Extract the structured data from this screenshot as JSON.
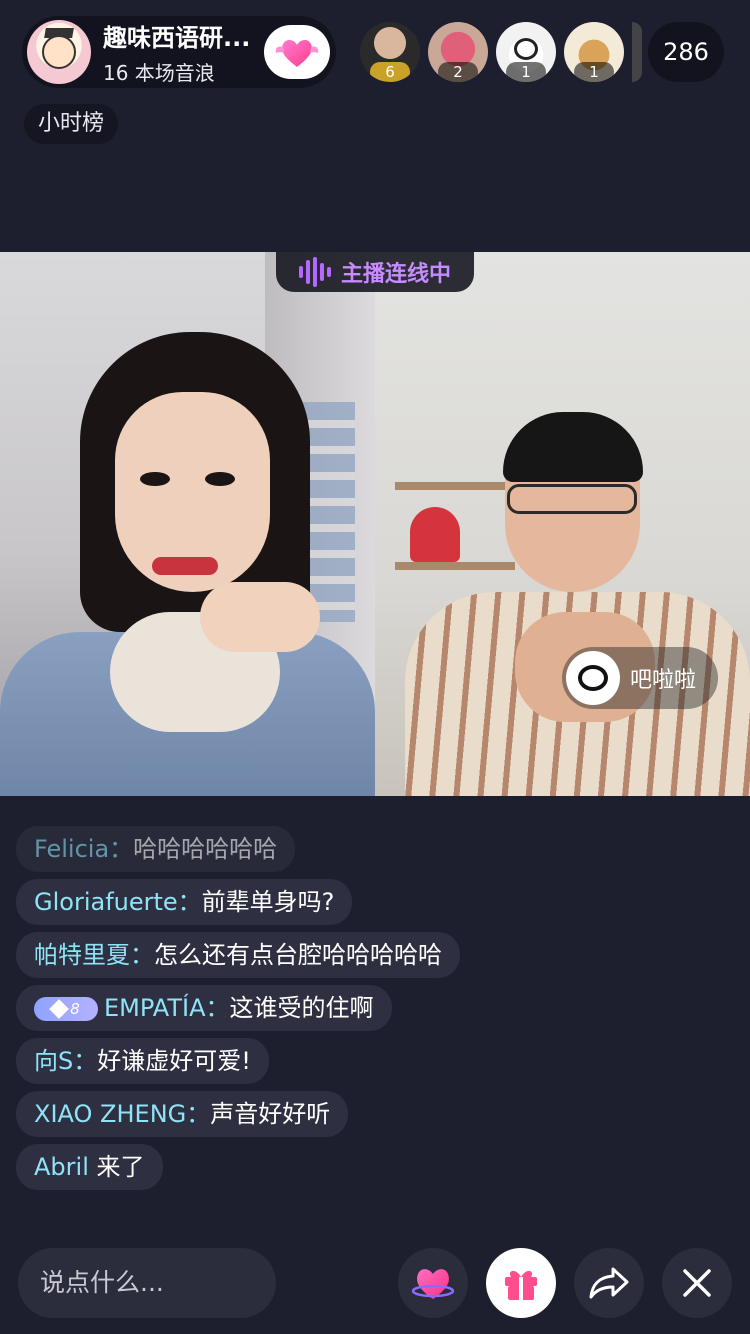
{
  "host": {
    "name": "趣味西语研...",
    "subtitle": "16 本场音浪"
  },
  "top_viewers": [
    {
      "rank_badge": "6"
    },
    {
      "rank_badge": "2"
    },
    {
      "rank_badge": "1"
    },
    {
      "rank_badge": "1"
    }
  ],
  "viewer_count": "286",
  "rank_label": "小时榜",
  "live_tag": "主播连线中",
  "guest": {
    "name": "吧啦啦"
  },
  "chat": [
    {
      "user": "Felicia：",
      "text": "哈哈哈哈哈哈"
    },
    {
      "user": "Gloriafuerte：",
      "text": "前辈单身吗?"
    },
    {
      "user": "帕特里夏：",
      "text": "怎么还有点台腔哈哈哈哈哈"
    },
    {
      "user": "EMPATÍA：",
      "text": "这谁受的住啊",
      "level": "8"
    },
    {
      "user": "向S：",
      "text": "好谦虚好可爱!"
    },
    {
      "user": "XIAO ZHENG：",
      "text": "声音好好听"
    },
    {
      "user": "Abril",
      "text": " 来了"
    }
  ],
  "bottom": {
    "input_placeholder": "说点什么..."
  },
  "colors": {
    "background": "#1e1f2e",
    "chat_username": "#8fe3f6",
    "live_tag_purple": "#b468ff",
    "gift_pink": "#ff4d8d"
  },
  "icons": [
    "heart-icon",
    "gift-icon",
    "share-icon",
    "close-icon",
    "sound-wave-icon"
  ]
}
